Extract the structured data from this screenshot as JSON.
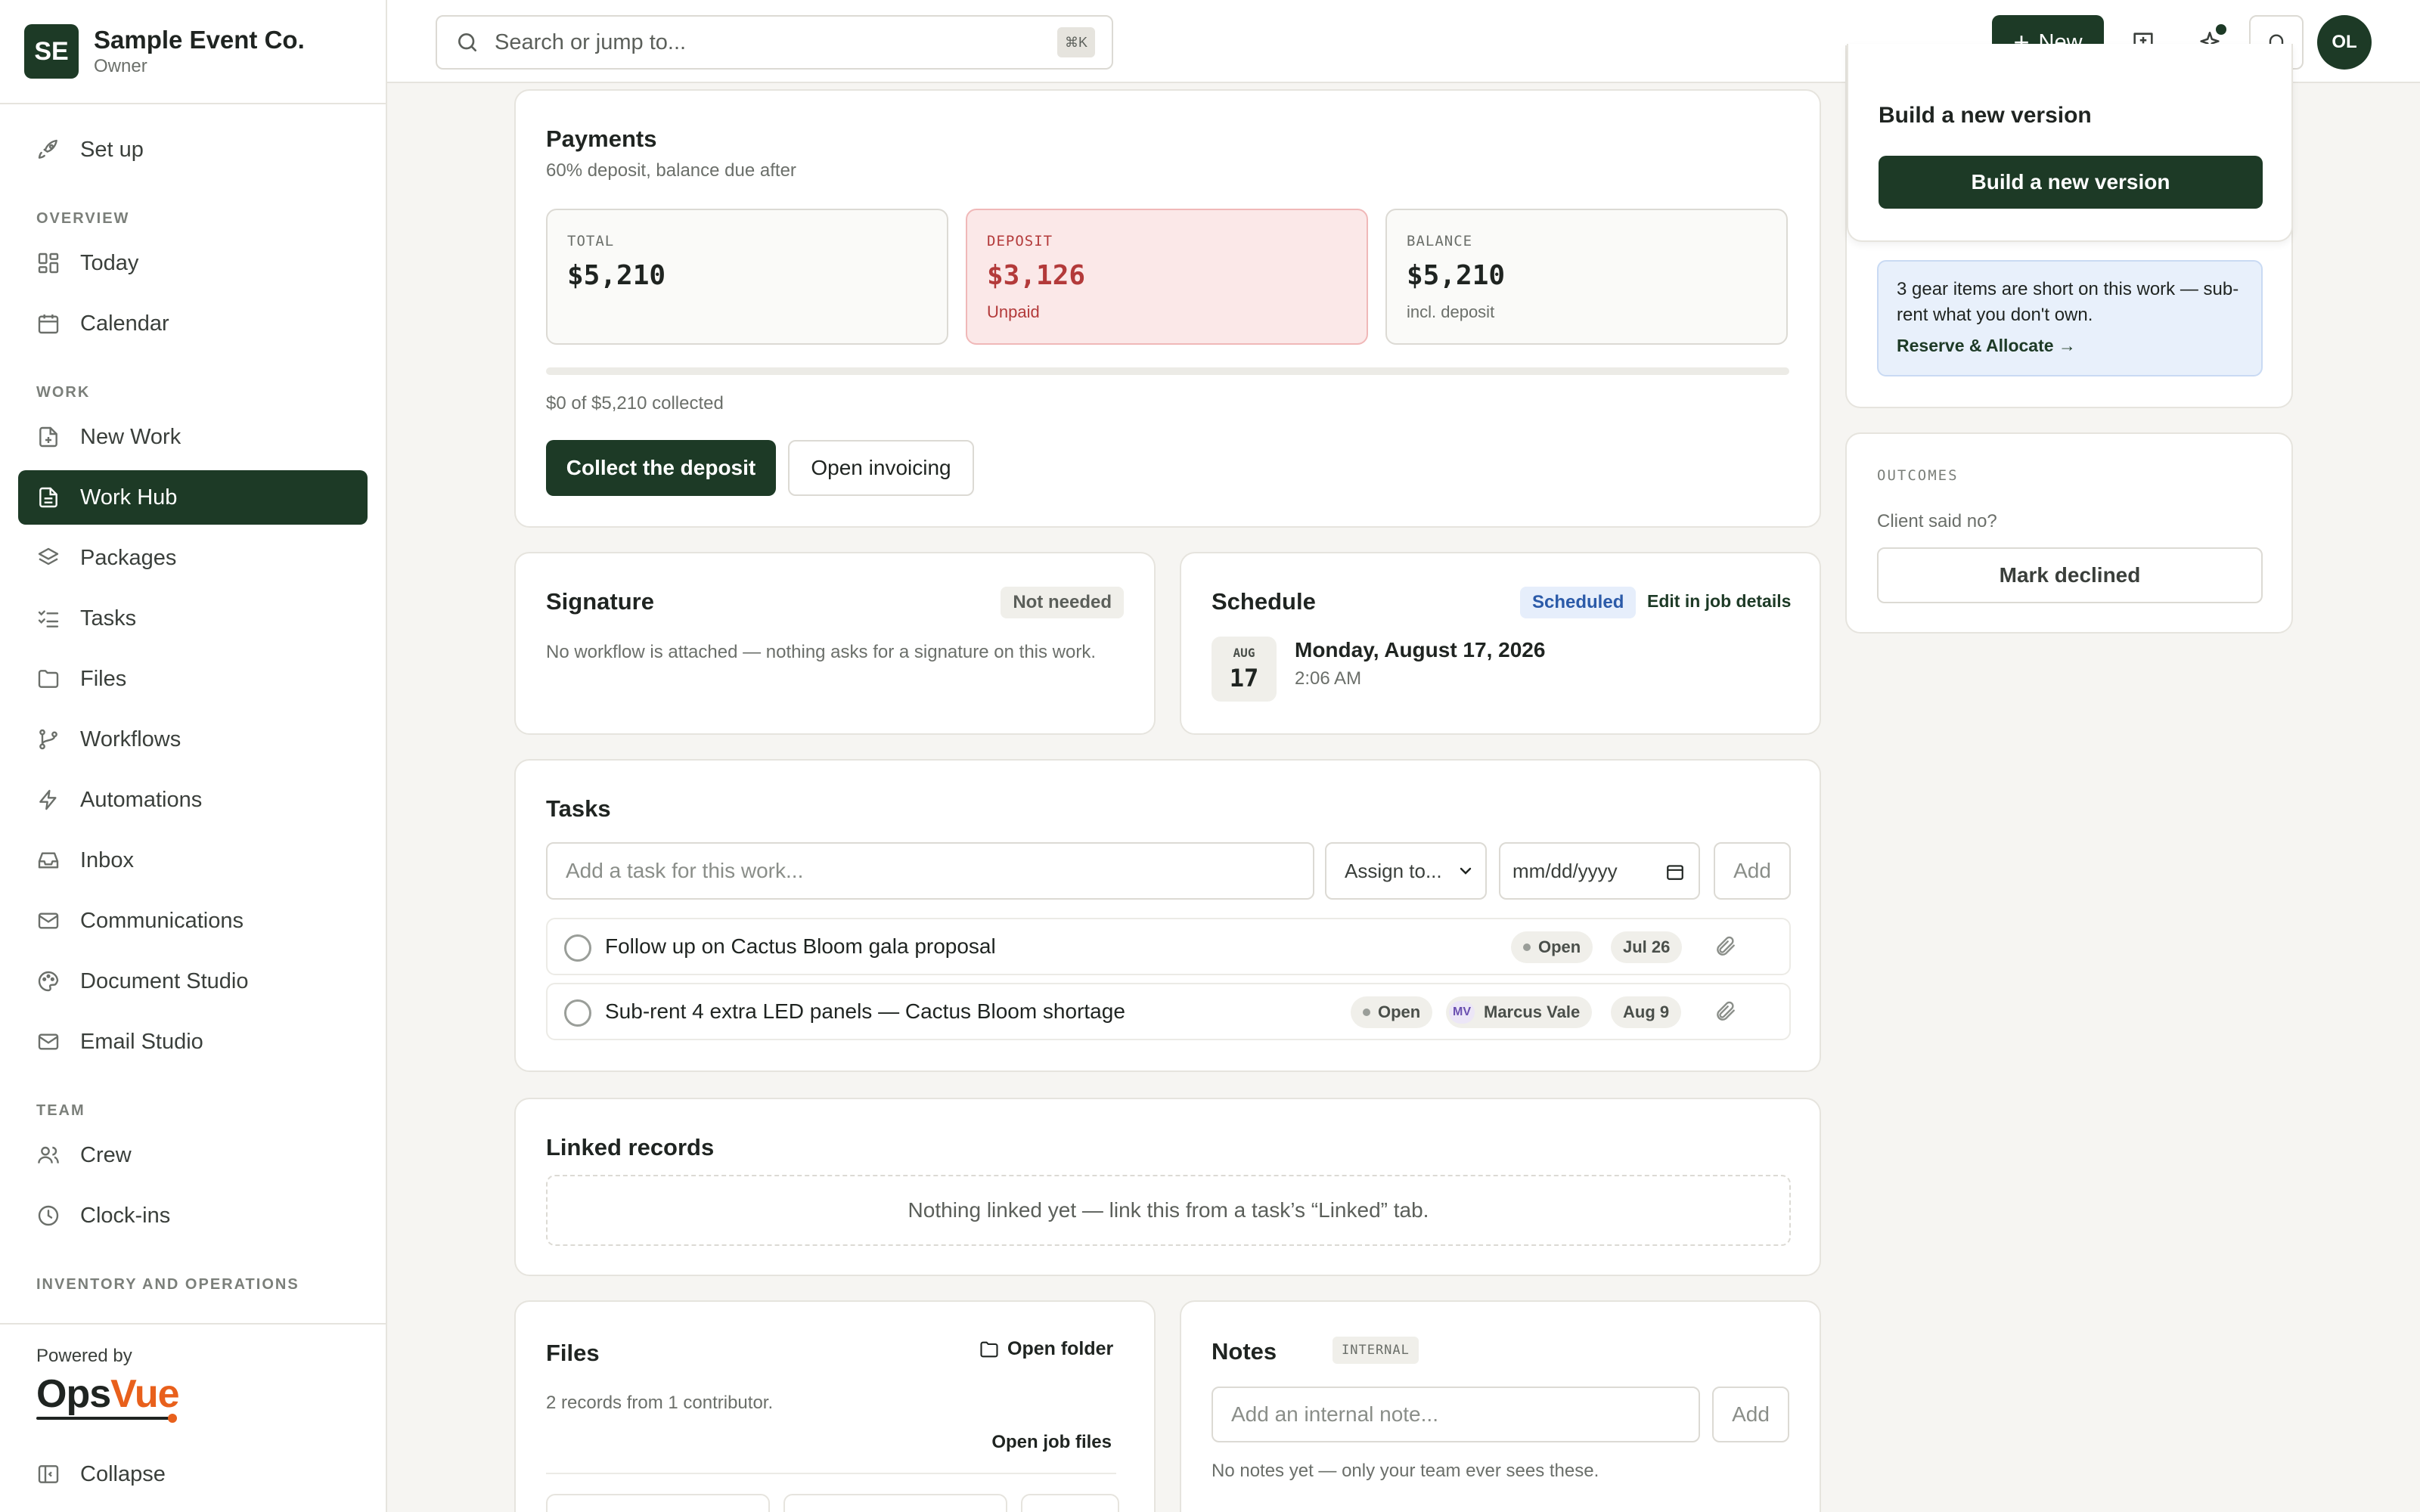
{
  "org": {
    "initials": "SE",
    "name": "Sample Event Co.",
    "role": "Owner"
  },
  "sidebar": {
    "setup": "Set up",
    "sections": {
      "overview": "OVERVIEW",
      "work": "WORK",
      "team": "TEAM",
      "inventory": "INVENTORY AND OPERATIONS"
    },
    "items": {
      "today": "Today",
      "calendar": "Calendar",
      "new_work": "New Work",
      "work_hub": "Work Hub",
      "packages": "Packages",
      "tasks": "Tasks",
      "files": "Files",
      "workflows": "Workflows",
      "automations": "Automations",
      "inbox": "Inbox",
      "communications": "Communications",
      "document_studio": "Document Studio",
      "email_studio": "Email Studio",
      "crew": "Crew",
      "clock_ins": "Clock-ins"
    },
    "powered_by": "Powered by",
    "brand_ops": "Ops",
    "brand_vue": "Vue",
    "collapse": "Collapse"
  },
  "topbar": {
    "search_placeholder": "Search or jump to...",
    "shortcut": "⌘K",
    "new_label": "New",
    "avatar_initials": "OL"
  },
  "payments": {
    "title": "Payments",
    "subtitle": "60% deposit, balance due after",
    "total": {
      "label": "TOTAL",
      "value": "$5,210"
    },
    "deposit": {
      "label": "DEPOSIT",
      "value": "$3,126",
      "status": "Unpaid"
    },
    "balance": {
      "label": "BALANCE",
      "value": "$5,210",
      "note": "incl. deposit"
    },
    "collected_fraction": 0,
    "collected_text": "$0 of $5,210 collected",
    "collect_button": "Collect the deposit",
    "invoicing_button": "Open invoicing"
  },
  "signature": {
    "title": "Signature",
    "badge": "Not needed",
    "description": "No workflow is attached — nothing asks for a signature on this work."
  },
  "schedule": {
    "title": "Schedule",
    "badge": "Scheduled",
    "edit_link": "Edit in job details",
    "month": "AUG",
    "day": "17",
    "date": "Monday, August 17, 2026",
    "time": "2:06 AM"
  },
  "tasks": {
    "title": "Tasks",
    "input_placeholder": "Add a task for this work...",
    "assign_placeholder": "Assign to...",
    "date_placeholder": "mm/dd/yyyy",
    "add_button": "Add",
    "items": [
      {
        "text": "Follow up on Cactus Bloom gala proposal",
        "status": "Open",
        "due": "Jul 26"
      },
      {
        "text": "Sub-rent 4 extra LED panels — Cactus Bloom shortage",
        "status": "Open",
        "assignee_initials": "MV",
        "assignee": "Marcus Vale",
        "due": "Aug 9"
      }
    ]
  },
  "linked_records": {
    "title": "Linked records",
    "empty": "Nothing linked yet — link this from a task’s “Linked” tab."
  },
  "files": {
    "title": "Files",
    "open_folder": "Open folder",
    "summary": "2 records from 1 contributor.",
    "open_job_files": "Open job files"
  },
  "notes": {
    "title": "Notes",
    "badge": "INTERNAL",
    "input_placeholder": "Add an internal note...",
    "add_button": "Add",
    "empty": "No notes yet — only your team ever sees these."
  },
  "right_panel": {
    "version_heading": "Build a new version",
    "version_button": "Build a new version",
    "gear_alert": "3 gear items are short on this work — sub-rent what you don't own.",
    "gear_link": "Reserve & Allocate →",
    "outcomes_label": "OUTCOMES",
    "outcomes_question": "Client said no?",
    "outcomes_button": "Mark declined"
  },
  "colors": {
    "brand": "#1d3a26",
    "accent": "#e8601c",
    "danger": "#b33a3a",
    "info_bg": "#e8f0fb"
  }
}
